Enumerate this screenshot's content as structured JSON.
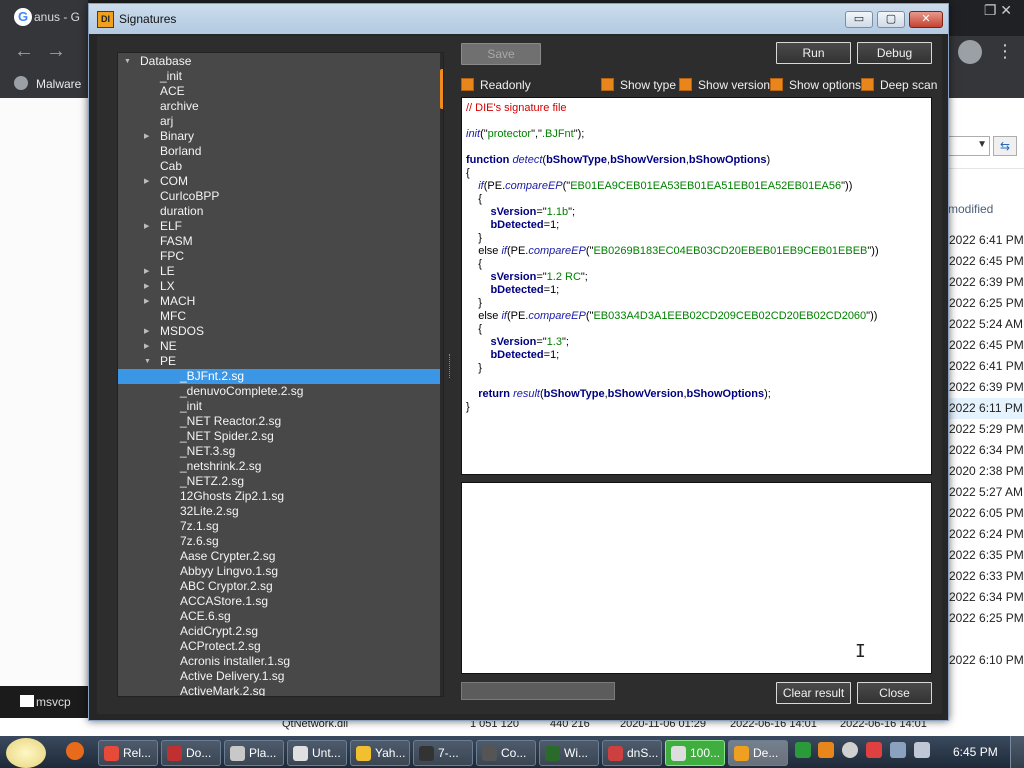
{
  "background": {
    "browser_tab_title": "anus - G",
    "bookmark_label": "Malware",
    "explorer_column_title": "modified",
    "explorer_dates": [
      "2022 6:41 PM",
      "2022 6:45 PM",
      "2022 6:39 PM",
      "2022 6:25 PM",
      "2022 5:24 AM",
      "2022 6:45 PM",
      "2022 6:41 PM",
      "2022 6:39 PM",
      "2022 6:11 PM",
      "2022 5:29 PM",
      "2022 6:34 PM",
      "2020 2:38 PM",
      "2022 5:27 AM",
      "2022 6:05 PM",
      "2022 6:24 PM",
      "2022 6:35 PM",
      "2022 6:33 PM",
      "2022 6:34 PM",
      "2022 6:25 PM",
      "",
      "2022 6:10 PM"
    ],
    "msv_label": "msvcp",
    "file_row": {
      "name": "QtNetwork.dll",
      "size": "1 051 120",
      "packed": "440 216",
      "modified": "2020-11-06 01:29",
      "created": "2022-06-16 14:01",
      "accessed": "2022-06-16 14:01"
    }
  },
  "taskbar": {
    "buttons": [
      "Rel...",
      "Do...",
      "Pla...",
      "Unt...",
      "Yah...",
      "7-...",
      "Co...",
      "Wi...",
      "dnS...",
      "100...",
      "De..."
    ],
    "clock": "6:45 PM"
  },
  "dialog": {
    "title": "Signatures",
    "icon_text": "DI",
    "min_glyph": "▭",
    "max_glyph": "▢",
    "close_glyph": "✕",
    "buttons": {
      "save": "Save",
      "run": "Run",
      "debug": "Debug",
      "clear_result": "Clear result",
      "close": "Close"
    },
    "options": {
      "readonly": "Readonly",
      "show_type": "Show type",
      "show_version": "Show version",
      "show_options": "Show options",
      "deep_scan": "Deep scan"
    },
    "tree": [
      {
        "label": "Database",
        "level": 0,
        "arrow": "down"
      },
      {
        "label": "_init",
        "level": 1,
        "arrow": ""
      },
      {
        "label": "ACE",
        "level": 1,
        "arrow": ""
      },
      {
        "label": "archive",
        "level": 1,
        "arrow": ""
      },
      {
        "label": "arj",
        "level": 1,
        "arrow": ""
      },
      {
        "label": "Binary",
        "level": 1,
        "arrow": "right"
      },
      {
        "label": "Borland",
        "level": 1,
        "arrow": ""
      },
      {
        "label": "Cab",
        "level": 1,
        "arrow": ""
      },
      {
        "label": "COM",
        "level": 1,
        "arrow": "right"
      },
      {
        "label": "CurIcoBPP",
        "level": 1,
        "arrow": ""
      },
      {
        "label": "duration",
        "level": 1,
        "arrow": ""
      },
      {
        "label": "ELF",
        "level": 1,
        "arrow": "right"
      },
      {
        "label": "FASM",
        "level": 1,
        "arrow": ""
      },
      {
        "label": "FPC",
        "level": 1,
        "arrow": ""
      },
      {
        "label": "LE",
        "level": 1,
        "arrow": "right"
      },
      {
        "label": "LX",
        "level": 1,
        "arrow": "right"
      },
      {
        "label": "MACH",
        "level": 1,
        "arrow": "right"
      },
      {
        "label": "MFC",
        "level": 1,
        "arrow": ""
      },
      {
        "label": "MSDOS",
        "level": 1,
        "arrow": "right"
      },
      {
        "label": "NE",
        "level": 1,
        "arrow": "right"
      },
      {
        "label": "PE",
        "level": 1,
        "arrow": "down"
      },
      {
        "label": "_BJFnt.2.sg",
        "level": 2,
        "arrow": "",
        "selected": true
      },
      {
        "label": "_denuvoComplete.2.sg",
        "level": 2,
        "arrow": ""
      },
      {
        "label": "_init",
        "level": 2,
        "arrow": ""
      },
      {
        "label": "_NET Reactor.2.sg",
        "level": 2,
        "arrow": ""
      },
      {
        "label": "_NET Spider.2.sg",
        "level": 2,
        "arrow": ""
      },
      {
        "label": "_NET.3.sg",
        "level": 2,
        "arrow": ""
      },
      {
        "label": "_netshrink.2.sg",
        "level": 2,
        "arrow": ""
      },
      {
        "label": "_NETZ.2.sg",
        "level": 2,
        "arrow": ""
      },
      {
        "label": "12Ghosts Zip2.1.sg",
        "level": 2,
        "arrow": ""
      },
      {
        "label": "32Lite.2.sg",
        "level": 2,
        "arrow": ""
      },
      {
        "label": "7z.1.sg",
        "level": 2,
        "arrow": ""
      },
      {
        "label": "7z.6.sg",
        "level": 2,
        "arrow": ""
      },
      {
        "label": "Aase Crypter.2.sg",
        "level": 2,
        "arrow": ""
      },
      {
        "label": "Abbyy Lingvo.1.sg",
        "level": 2,
        "arrow": ""
      },
      {
        "label": "ABC Cryptor.2.sg",
        "level": 2,
        "arrow": ""
      },
      {
        "label": "ACCAStore.1.sg",
        "level": 2,
        "arrow": ""
      },
      {
        "label": "ACE.6.sg",
        "level": 2,
        "arrow": ""
      },
      {
        "label": "AcidCrypt.2.sg",
        "level": 2,
        "arrow": ""
      },
      {
        "label": "ACProtect.2.sg",
        "level": 2,
        "arrow": ""
      },
      {
        "label": "Acronis installer.1.sg",
        "level": 2,
        "arrow": ""
      },
      {
        "label": "Active Delivery.1.sg",
        "level": 2,
        "arrow": ""
      },
      {
        "label": "ActiveMark.2.sg",
        "level": 2,
        "arrow": ""
      }
    ],
    "code_lines": [
      [
        [
          "c-com",
          "// DIE's signature file"
        ]
      ],
      [],
      [
        [
          "c-fn",
          "init"
        ],
        [
          "c-p",
          "(\""
        ],
        [
          "c-str",
          "protector"
        ],
        [
          "c-p",
          "\",\""
        ],
        [
          "c-str",
          ".BJFnt"
        ],
        [
          "c-p",
          "\");"
        ]
      ],
      [],
      [
        [
          "c-kw",
          "function "
        ],
        [
          "c-fn",
          "detect"
        ],
        [
          "c-p",
          "("
        ],
        [
          "c-var",
          "bShowType"
        ],
        [
          "c-p",
          ","
        ],
        [
          "c-var",
          "bShowVersion"
        ],
        [
          "c-p",
          ","
        ],
        [
          "c-var",
          "bShowOptions"
        ],
        [
          "c-p",
          ")"
        ]
      ],
      [
        [
          "c-p",
          "{"
        ]
      ],
      [
        [
          "c-p",
          "    "
        ],
        [
          "c-fn",
          "if"
        ],
        [
          "c-p",
          "(PE."
        ],
        [
          "c-fn",
          "compareEP"
        ],
        [
          "c-p",
          "(\""
        ],
        [
          "c-str",
          "EB01EA9CEB01EA53EB01EA51EB01EA52EB01EA56"
        ],
        [
          "c-p",
          "\"))"
        ]
      ],
      [
        [
          "c-p",
          "    {"
        ]
      ],
      [
        [
          "c-p",
          "        "
        ],
        [
          "c-var",
          "sVersion"
        ],
        [
          "c-p",
          "=\""
        ],
        [
          "c-str",
          "1.1b"
        ],
        [
          "c-p",
          "\";"
        ]
      ],
      [
        [
          "c-p",
          "        "
        ],
        [
          "c-var",
          "bDetected"
        ],
        [
          "c-p",
          "=1;"
        ]
      ],
      [
        [
          "c-p",
          "    }"
        ]
      ],
      [
        [
          "c-p",
          "    else "
        ],
        [
          "c-fn",
          "if"
        ],
        [
          "c-p",
          "(PE."
        ],
        [
          "c-fn",
          "compareEP"
        ],
        [
          "c-p",
          "(\""
        ],
        [
          "c-str",
          "EB0269B183EC04EB03CD20EBEB01EB9CEB01EBEB"
        ],
        [
          "c-p",
          "\"))"
        ]
      ],
      [
        [
          "c-p",
          "    {"
        ]
      ],
      [
        [
          "c-p",
          "        "
        ],
        [
          "c-var",
          "sVersion"
        ],
        [
          "c-p",
          "=\""
        ],
        [
          "c-str",
          "1.2 RC"
        ],
        [
          "c-p",
          "\";"
        ]
      ],
      [
        [
          "c-p",
          "        "
        ],
        [
          "c-var",
          "bDetected"
        ],
        [
          "c-p",
          "=1;"
        ]
      ],
      [
        [
          "c-p",
          "    }"
        ]
      ],
      [
        [
          "c-p",
          "    else "
        ],
        [
          "c-fn",
          "if"
        ],
        [
          "c-p",
          "(PE."
        ],
        [
          "c-fn",
          "compareEP"
        ],
        [
          "c-p",
          "(\""
        ],
        [
          "c-str",
          "EB033A4D3A1EEB02CD209CEB02CD20EB02CD2060"
        ],
        [
          "c-p",
          "\"))"
        ]
      ],
      [
        [
          "c-p",
          "    {"
        ]
      ],
      [
        [
          "c-p",
          "        "
        ],
        [
          "c-var",
          "sVersion"
        ],
        [
          "c-p",
          "=\""
        ],
        [
          "c-str",
          "1.3"
        ],
        [
          "c-p",
          "\";"
        ]
      ],
      [
        [
          "c-p",
          "        "
        ],
        [
          "c-var",
          "bDetected"
        ],
        [
          "c-p",
          "=1;"
        ]
      ],
      [
        [
          "c-p",
          "    }"
        ]
      ],
      [],
      [
        [
          "c-p",
          "    "
        ],
        [
          "c-kw",
          "return "
        ],
        [
          "c-fn",
          "result"
        ],
        [
          "c-p",
          "("
        ],
        [
          "c-var",
          "bShowType"
        ],
        [
          "c-p",
          ","
        ],
        [
          "c-var",
          "bShowVersion"
        ],
        [
          "c-p",
          ","
        ],
        [
          "c-var",
          "bShowOptions"
        ],
        [
          "c-p",
          ");"
        ]
      ],
      [
        [
          "c-p",
          "}"
        ]
      ]
    ]
  }
}
